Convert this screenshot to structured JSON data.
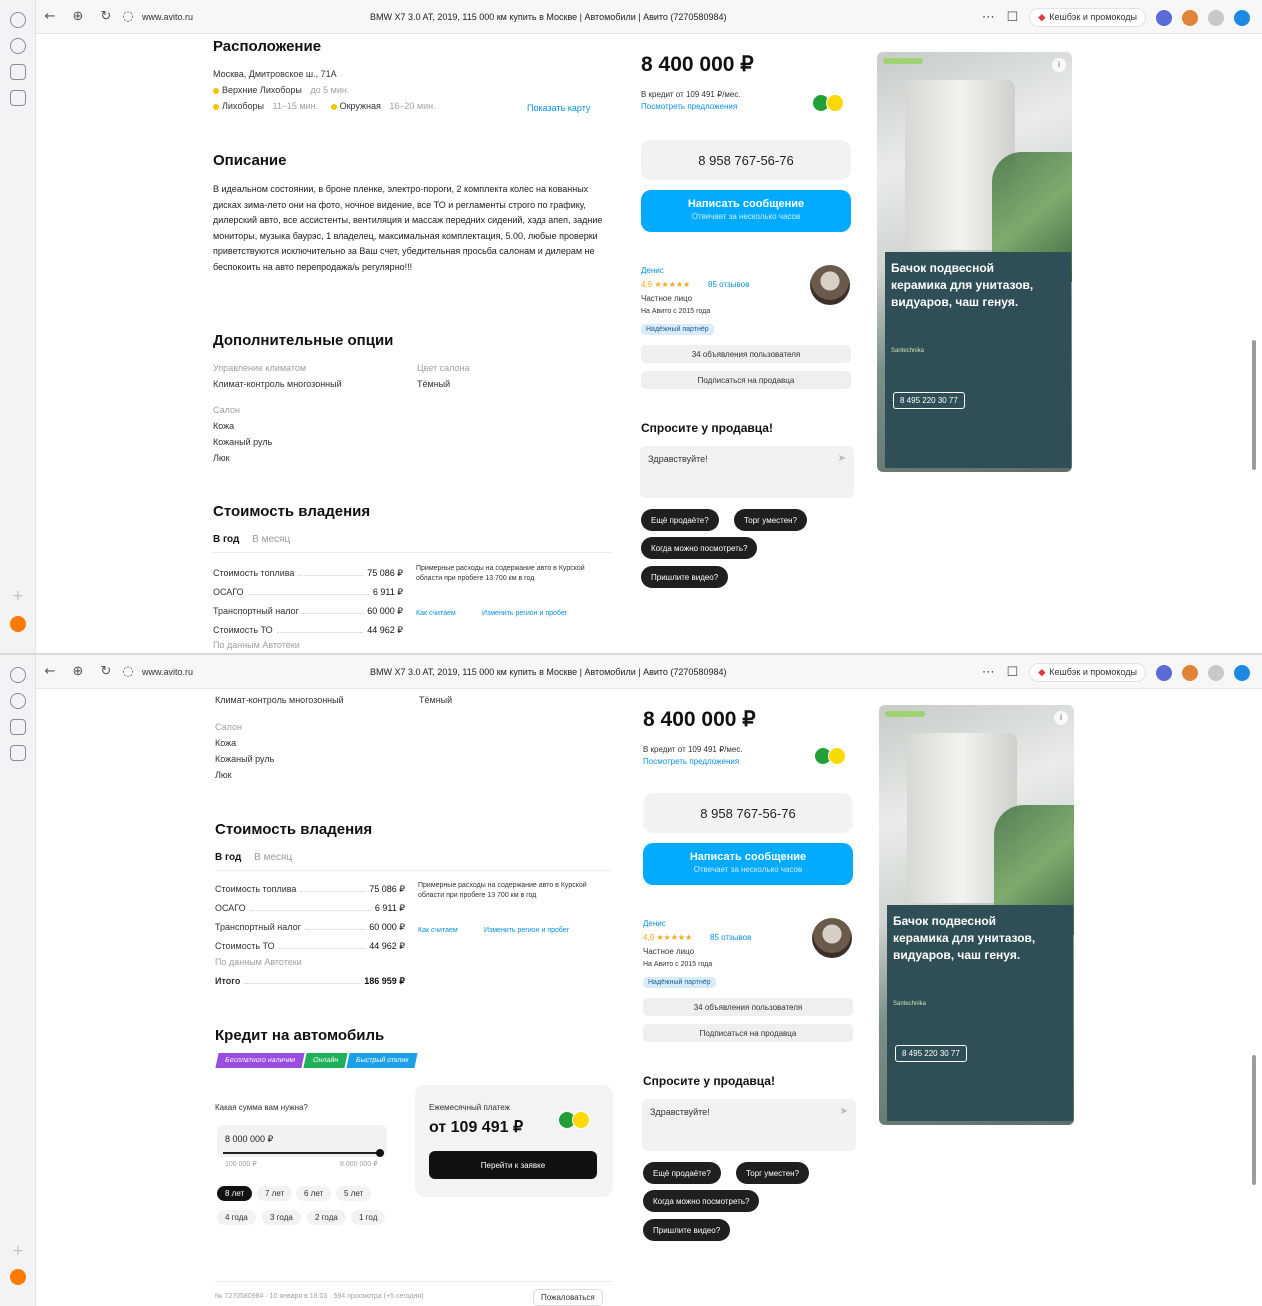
{
  "browser": {
    "url": "www.avito.ru",
    "tab_title": "BMW X7 3.0 AT, 2019, 115 000 км купить в Москве | Автомобили | Авито (7270580984)",
    "promo": "Кешбэк и промокоды"
  },
  "location": {
    "heading": "Расположение",
    "address": "Москва, Дмитровское ш., 71А",
    "metro": [
      {
        "name": "Верхние Лихоборы",
        "dist": "до 5 мин.",
        "color": "#f2c500"
      },
      {
        "name": "Лихоборы",
        "dist": "11–15 мин.",
        "color": "#f2c500"
      },
      {
        "name": "Окружная",
        "dist": "16–20 мин.",
        "color": "#f2c500"
      }
    ],
    "map_link": "Показать карту"
  },
  "description": {
    "heading": "Описание",
    "text": "В идеальном состоянии, в броне пленке, электро-пороги, 2 комплекта колес на кованных дисках зима-лето они на фото, ночное видение, все ТО и регламенты строго по графику, дилерский авто, все ассистенты, вентиляция и массаж передних сидений, хэдз апеп, задние мониторы, музыка баурэс, 1 владелец, максимальная комплектация, 5.00, любые проверки приветствуются исключительно за Ваш счет, убедительная просьба салонам и дилерам не беспокоить на авто перепродажа/ь регулярно!!!"
  },
  "options": {
    "heading": "Дополнительные опции",
    "climate_label": "Управление климатом",
    "climate_value": "Климат-контроль многозонный",
    "color_label": "Цвет салона",
    "color_value": "Тёмный",
    "salon_label": "Салон",
    "salon_items": [
      "Кожа",
      "Кожаный руль",
      "Люк"
    ]
  },
  "ownership": {
    "heading": "Стоимость владения",
    "tab_year": "В год",
    "tab_month": "В месяц",
    "rows": [
      {
        "label": "Стоимость топлива",
        "value": "75 086 ₽"
      },
      {
        "label": "ОСАГО",
        "value": "6 911 ₽"
      },
      {
        "label": "Транспортный налог",
        "value": "60 000 ₽"
      },
      {
        "label": "Стоимость ТО",
        "value": "44 962 ₽"
      }
    ],
    "source": "По данным Автотеки",
    "total_label": "Итого",
    "total_value": "186 959 ₽",
    "note": "Примерные расходы на содержание авто в Курской области при пробеге 13 700 км в год",
    "how_link": "Как считаем",
    "change_link": "Изменить регион и пробег"
  },
  "sidebar": {
    "price": "8 400 000 ₽",
    "credit_text": "В кредит от 109 491 ₽/мес.",
    "credit_link": "Посмотреть предложения",
    "phone": "8 958 767-56-76",
    "message_button": "Написать сообщение",
    "message_sub": "Отвечает за несколько часов",
    "seller_name": "Денис",
    "seller_rating": "4,9 ★★★★★",
    "seller_reviews": "85 отзывов",
    "seller_type": "Частное лицо",
    "seller_since": "На Авито с 2015 года",
    "trust_badge": "Надёжный партнёр",
    "ads_button": "34 объявления пользователя",
    "subscribe_button": "Подписаться на продавца",
    "ask_heading": "Спросите у продавца!",
    "ask_placeholder": "Здравствуйте!",
    "chips": [
      "Ещё продаёте?",
      "Торг уместен?",
      "Когда можно посмотреть?",
      "Пришлите видео?"
    ]
  },
  "ad": {
    "title": "Бачок подвесной керамика для унитазов, видуаров, чаш генуя.",
    "brand": "Santechnika",
    "phone": "8 495 220 30 77"
  },
  "credit": {
    "heading": "Кредит на автомобиль",
    "badges": [
      "Бесплатного наличии",
      "Онлайн",
      "Быстрый отклик"
    ],
    "question": "Какая сумма вам нужна?",
    "amount": "8 000 000 ₽",
    "min": "100 000 ₽",
    "max": "8 000 000 ₽",
    "terms": [
      "8 лет",
      "7 лет",
      "6 лет",
      "5 лет",
      "4 года",
      "3 года",
      "2 года",
      "1 год"
    ],
    "monthly_label": "Ежемесячный платеж",
    "monthly_value": "от 109 491 ₽",
    "go_button": "Перейти к заявке",
    "slider_fraction": 0.98
  },
  "footer": {
    "meta": "№ 7270580984 · 10 января в 18:03 · 594 просмотра (+5 сегодня)",
    "complain": "Пожаловаться"
  }
}
